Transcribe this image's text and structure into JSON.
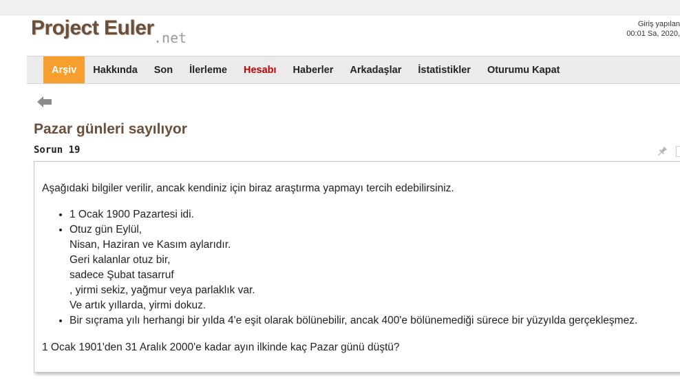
{
  "header": {
    "logo_main": "Project Euler",
    "logo_sub": ".net",
    "login_line1": "Giriş yapılan",
    "login_line2": "00:01 Sa, 2020,"
  },
  "nav": {
    "items": [
      {
        "label": "Arşiv"
      },
      {
        "label": "Hakkında"
      },
      {
        "label": "Son"
      },
      {
        "label": "İlerleme"
      },
      {
        "label": "Hesabı"
      },
      {
        "label": "Haberler"
      },
      {
        "label": "Arkadaşlar"
      },
      {
        "label": "İstatistikler"
      },
      {
        "label": "Oturumu Kapat"
      }
    ],
    "active_color": "#f79f2e",
    "alert_color": "#c00000"
  },
  "problem": {
    "title": "Pazar günleri sayılıyor",
    "id_label": "Sorun 19",
    "intro": "Aşağıdaki bilgiler verilir, ancak kendiniz için biraz araştırma yapmayı tercih edebilirsiniz.",
    "fact1": "1 Ocak 1900 Pazartesi idi.",
    "fact2_lines": [
      "Otuz gün Eylül,",
      "Nisan, Haziran ve Kasım aylarıdır.",
      "Geri kalanlar otuz bir,",
      "sadece Şubat tasarruf",
      ", yirmi sekiz, yağmur veya parlaklık var.",
      "Ve artık yıllarda, yirmi dokuz."
    ],
    "fact3": "Bir sıçrama yılı herhangi bir yılda 4'e eşit olarak bölünebilir, ancak 400'e bölünemediği sürece bir yüzyılda gerçekleşmez.",
    "question": "1 Ocak 1901'den 31 Aralık 2000'e kadar ayın ilkinde kaç Pazar günü düştü?"
  },
  "icons": {
    "back": "back-arrow-icon",
    "pin": "pin-icon"
  }
}
